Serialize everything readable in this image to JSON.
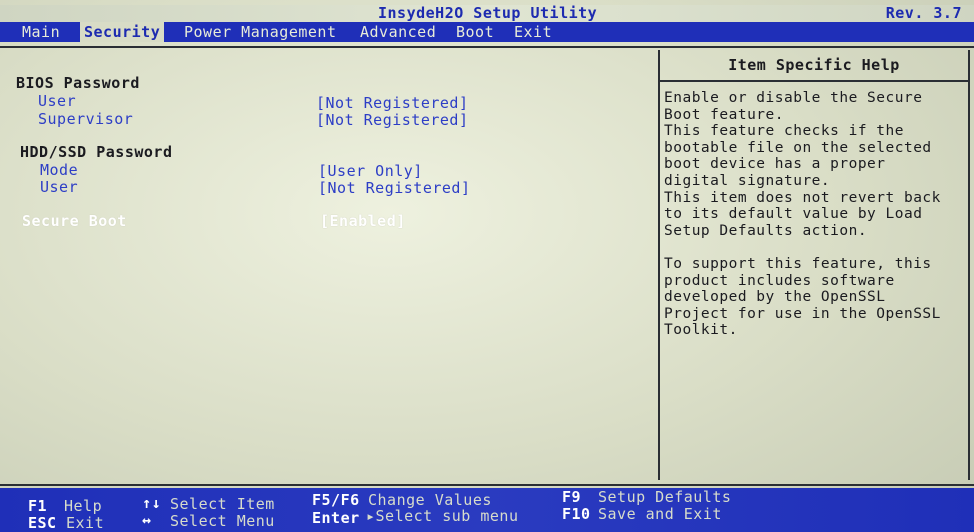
{
  "title_bar": {
    "title": "InsydeH2O Setup Utility",
    "revision": "Rev. 3.7"
  },
  "menu": {
    "items": [
      {
        "label": "Main",
        "active": false
      },
      {
        "label": "Security",
        "active": true
      },
      {
        "label": "Power Management",
        "active": false
      },
      {
        "label": "Advanced",
        "active": false
      },
      {
        "label": "Boot",
        "active": false
      },
      {
        "label": "Exit",
        "active": false
      }
    ]
  },
  "main": {
    "bios_password": {
      "title": "BIOS Password",
      "rows": [
        {
          "label": "User",
          "value": "[Not Registered]"
        },
        {
          "label": "Supervisor",
          "value": "[Not Registered]"
        }
      ]
    },
    "hdd_password": {
      "title": "HDD/SSD Password",
      "rows": [
        {
          "label": "Mode",
          "value": "[User Only]"
        },
        {
          "label": "User",
          "value": "[Not Registered]"
        }
      ]
    },
    "secure_boot": {
      "label": "Secure Boot",
      "value": "[Enabled]"
    }
  },
  "help": {
    "header": "Item Specific Help",
    "lines": [
      "Enable or disable the Secure",
      "Boot feature.",
      "This feature checks if the",
      "bootable file on the selected",
      "boot device has a proper",
      "digital signature.",
      "This item does not revert back",
      "to its default value by Load",
      "Setup Defaults action.",
      "",
      "To support this feature, this",
      "product includes software",
      "developed by the OpenSSL",
      "Project for use in the OpenSSL",
      "Toolkit."
    ]
  },
  "key_bar": {
    "f1_key": "F1",
    "f1_desc": "Help",
    "esc_key": "ESC",
    "esc_desc": "Exit",
    "updown_key": "↑↓",
    "updown_desc": "Select Item",
    "leftright_key": "↔",
    "leftright_desc": "Select Menu",
    "f5f6_key": "F5/F6",
    "f5f6_desc": "Change Values",
    "enter_key": "Enter",
    "enter_desc": "▸Select sub menu",
    "f9_key": "F9",
    "f9_desc": "Setup Defaults",
    "f10_key": "F10",
    "f10_desc": "Save and Exit"
  },
  "colors": {
    "accent_blue": "#1f2fb8",
    "background": "#d9ddc6",
    "text_dark": "#1b1b20"
  }
}
